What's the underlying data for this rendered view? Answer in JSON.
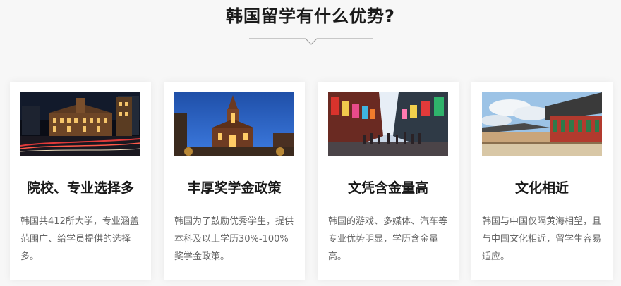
{
  "section": {
    "title": "韩国留学有什么优势?"
  },
  "cards": [
    {
      "heading": "院校、专业选择多",
      "text": "韩国共412所大学，专业涵盖范围广、给学员提供的选择多。",
      "image": "night-city-building-photo"
    },
    {
      "heading": "丰厚奖学金政策",
      "text": "韩国为了鼓励优秀学生，提供本科及以上学历30%-100%奖学金政策。",
      "image": "cathedral-at-dusk-photo"
    },
    {
      "heading": "文凭含金量高",
      "text": "韩国的游戏、多媒体、汽车等专业优势明显，学历含金量高。",
      "image": "shopping-street-photo"
    },
    {
      "heading": "文化相近",
      "text": "韩国与中国仅隔黄海相望，且与中国文化相近，留学生容易适应。",
      "image": "traditional-hanok-photo"
    }
  ]
}
